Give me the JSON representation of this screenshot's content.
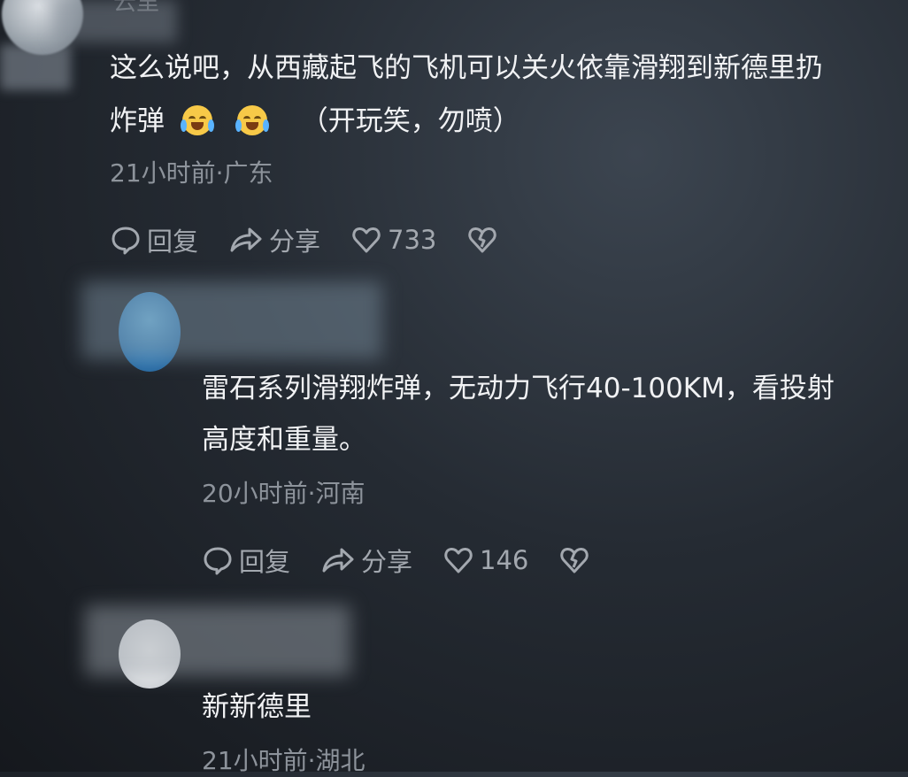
{
  "comments": [
    {
      "username": "云里",
      "text_line1": "这么说吧，从西藏起飞的飞机可以关火依靠滑翔到新德里扔",
      "text_line2_pre": "炸弹",
      "text_line2_post": "（开玩笑，勿喷）",
      "emoji_icon": "laugh-crying-emoji",
      "meta": "21小时前·广东",
      "reply_label": "回复",
      "share_label": "分享",
      "like_count": "733"
    },
    {
      "text_line1": "雷石系列滑翔炸弹，无动力飞行40-100KM，看投射",
      "text_line2": "高度和重量。",
      "meta": "20小时前·河南",
      "reply_label": "回复",
      "share_label": "分享",
      "like_count": "146"
    },
    {
      "text_line1": "新新德里",
      "meta": "21小时前·湖北"
    }
  ],
  "colors": {
    "background": "#22282f",
    "text": "#f1f2f4",
    "meta": "#8d939b",
    "action": "#a3a8af"
  }
}
